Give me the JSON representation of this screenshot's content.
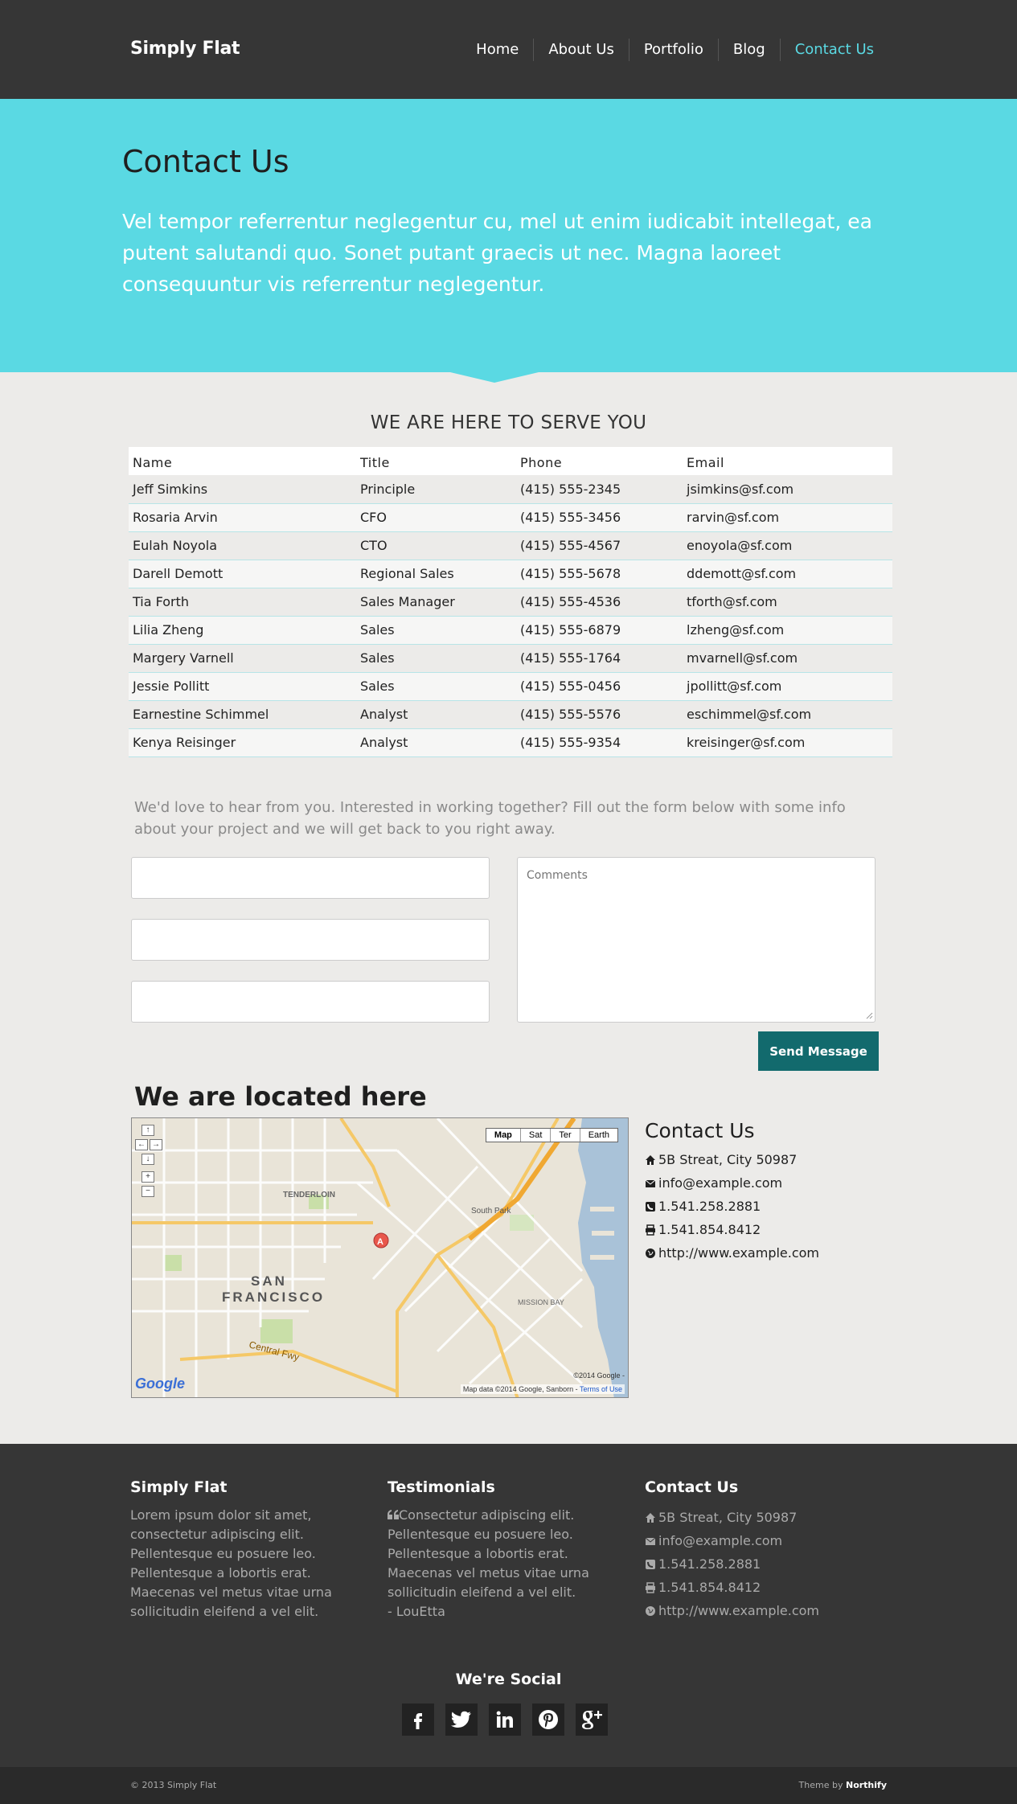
{
  "header": {
    "brand": "Simply Flat",
    "nav": [
      {
        "label": "Home"
      },
      {
        "label": "About Us"
      },
      {
        "label": "Portfolio"
      },
      {
        "label": "Blog"
      },
      {
        "label": "Contact Us"
      }
    ],
    "active_nav": "Contact Us",
    "accent_color": "#5ad9e3"
  },
  "hero": {
    "title": "Contact Us",
    "text": "Vel tempor referrentur neglegentur cu, mel ut enim iudicabit intellegat, ea putent salutandi quo. Sonet putant graecis ut nec. Magna laoreet consequuntur vis referrentur neglegentur."
  },
  "team": {
    "title": "WE ARE HERE TO SERVE YOU",
    "columns": [
      "Name",
      "Title",
      "Phone",
      "Email"
    ],
    "rows": [
      [
        "Jeff Simkins",
        "Principle",
        "(415) 555-2345",
        "jsimkins@sf.com"
      ],
      [
        "Rosaria Arvin",
        "CFO",
        "(415) 555-3456",
        "rarvin@sf.com"
      ],
      [
        "Eulah Noyola",
        "CTO",
        "(415) 555-4567",
        "enoyola@sf.com"
      ],
      [
        "Darell Demott",
        "Regional Sales",
        "(415) 555-5678",
        "ddemott@sf.com"
      ],
      [
        "Tia Forth",
        "Sales Manager",
        "(415) 555-4536",
        "tforth@sf.com"
      ],
      [
        "Lilia Zheng",
        "Sales",
        "(415) 555-6879",
        "lzheng@sf.com"
      ],
      [
        "Margery Varnell",
        "Sales",
        "(415) 555-1764",
        "mvarnell@sf.com"
      ],
      [
        "Jessie Pollitt",
        "Sales",
        "(415) 555-0456",
        "jpollitt@sf.com"
      ],
      [
        "Earnestine Schimmel",
        "Analyst",
        "(415) 555-5576",
        "eschimmel@sf.com"
      ],
      [
        "Kenya Reisinger",
        "Analyst",
        "(415) 555-9354",
        "kreisinger@sf.com"
      ]
    ]
  },
  "form": {
    "intro": "We'd love to hear from you. Interested in working together? Fill out the form below with some info about your project and we will get back to you right away.",
    "field1": "",
    "field2": "",
    "field3": "",
    "comments_placeholder": "Comments",
    "send_label": "Send Message",
    "button_color": "#126a6d"
  },
  "location": {
    "title": "We are located here",
    "map": {
      "types": [
        "Map",
        "Sat",
        "Ter",
        "Earth"
      ],
      "labels": {
        "city1": "SAN",
        "city2": "FRANCISCO",
        "district": "TENDERLOIN",
        "south_park": "South Park",
        "mission_bay": "MISSION BAY",
        "central_fwy": "Central Fwy",
        "marker": "A"
      },
      "copyright_short": "©2014 Google -",
      "copyright": "Map data ©2014 Google, Sanborn -",
      "terms": "Terms of Use",
      "google": "Google"
    },
    "contact_title": "Contact Us",
    "address": "5B Streat, City 50987",
    "email": "info@example.com",
    "phone": "1.541.258.2881",
    "fax": "1.541.854.8412",
    "website": "http://www.example.com"
  },
  "footer": {
    "about_title": "Simply Flat",
    "about_text": "Lorem ipsum dolor sit amet, consectetur adipiscing elit. Pellentesque eu posuere leo. Pellentesque a lobortis erat. Maecenas vel metus vitae urna sollicitudin eleifend a vel elit.",
    "testimonials_title": "Testimonials",
    "testimonial_text": "Consectetur adipiscing elit. Pellentesque eu posuere leo. Pellentesque a lobortis erat. Maecenas vel metus vitae urna sollicitudin eleifend a vel elit.",
    "testimonial_author": "- LouEtta",
    "contact_title": "Contact Us",
    "address": "5B Streat, City 50987",
    "email": "info@example.com",
    "phone": "1.541.258.2881",
    "fax": "1.541.854.8412",
    "website": "http://www.example.com",
    "social_title": "We're Social",
    "social_icons": [
      "facebook-icon",
      "twitter-icon",
      "linkedin-icon",
      "pinterest-icon",
      "google-plus-icon"
    ],
    "copyright": "© 2013 Simply Flat",
    "theme_by_prefix": "Theme by",
    "theme_by_name": "Northify"
  }
}
